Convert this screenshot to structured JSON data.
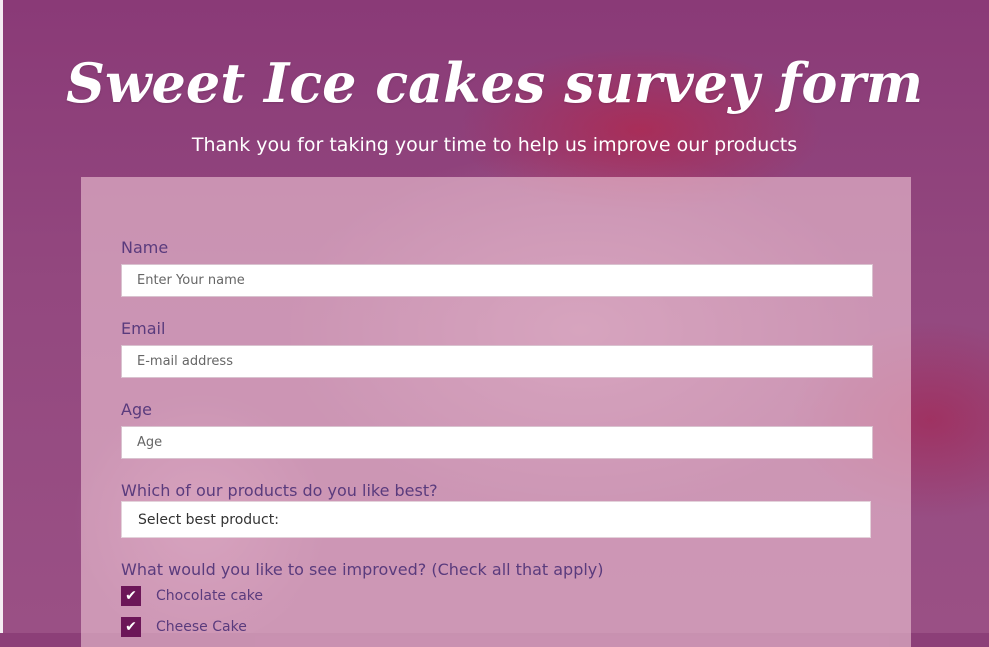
{
  "header": {
    "title": "Sweet Ice cakes survey form",
    "subtitle": "Thank you for taking your time to help us improve our products"
  },
  "form": {
    "name": {
      "label": "Name",
      "placeholder": "Enter Your name",
      "value": ""
    },
    "email": {
      "label": "Email",
      "placeholder": "E-mail address",
      "value": ""
    },
    "age": {
      "label": "Age",
      "placeholder": "Age",
      "value": ""
    },
    "product": {
      "label": "Which of our products do you like best?",
      "selected": "Select best product:"
    },
    "improve": {
      "label": "What would you like to see improved? (Check all that apply)",
      "options": [
        {
          "label": "Chocolate cake",
          "checked": true
        },
        {
          "label": "Cheese Cake",
          "checked": true
        }
      ]
    }
  },
  "colors": {
    "accent": "#6c1658",
    "label_text": "#5a3b7d",
    "background": "#8c3f78"
  },
  "icons": {
    "checkbox": "checkmark-icon"
  }
}
